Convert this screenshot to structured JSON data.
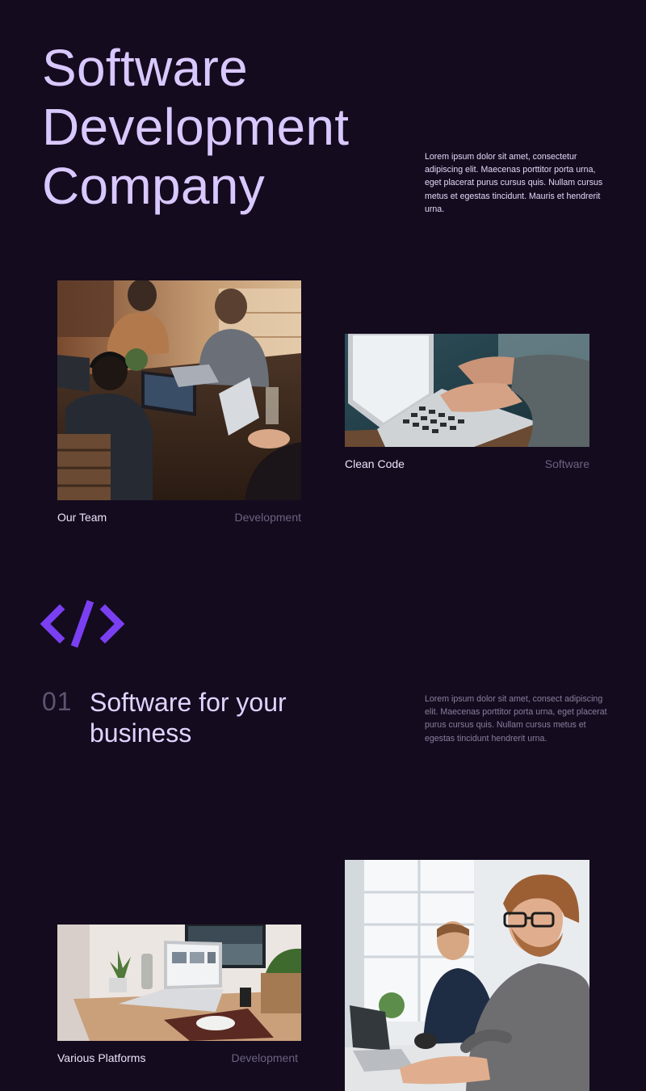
{
  "hero": {
    "title_lines": [
      "Software",
      "Development",
      "Company"
    ],
    "description": "Lorem ipsum dolor sit amet, consectetur adipiscing elit. Maecenas porttitor porta urna, eget placerat purus cursus quis. Nullam cursus metus et egestas tincidunt. Mauris et hendrerit urna."
  },
  "gallery": [
    {
      "title": "Our Team",
      "category": "Development",
      "image": "team-meeting-photo"
    },
    {
      "title": "Clean Code",
      "category": "Software",
      "image": "laptop-typing-photo"
    }
  ],
  "feature": {
    "icon": "code-brackets-icon",
    "number": "01",
    "title_lines": [
      "Software for your",
      "business"
    ],
    "description": "Lorem ipsum dolor sit amet, consect adipiscing elit. Maecenas porttitor porta urna, eget placerat purus cursus quis. Nullam cursus metus et egestas tincidunt hendrerit urna."
  },
  "gallery2": [
    {
      "title": "Various Platforms",
      "category": "Development",
      "image": "desk-laptop-photo"
    },
    {
      "image": "developers-office-photo"
    }
  ],
  "colors": {
    "background": "#140b1f",
    "title": "#d9c8ff",
    "accent": "#7b3ff2",
    "muted": "#6c6380"
  }
}
